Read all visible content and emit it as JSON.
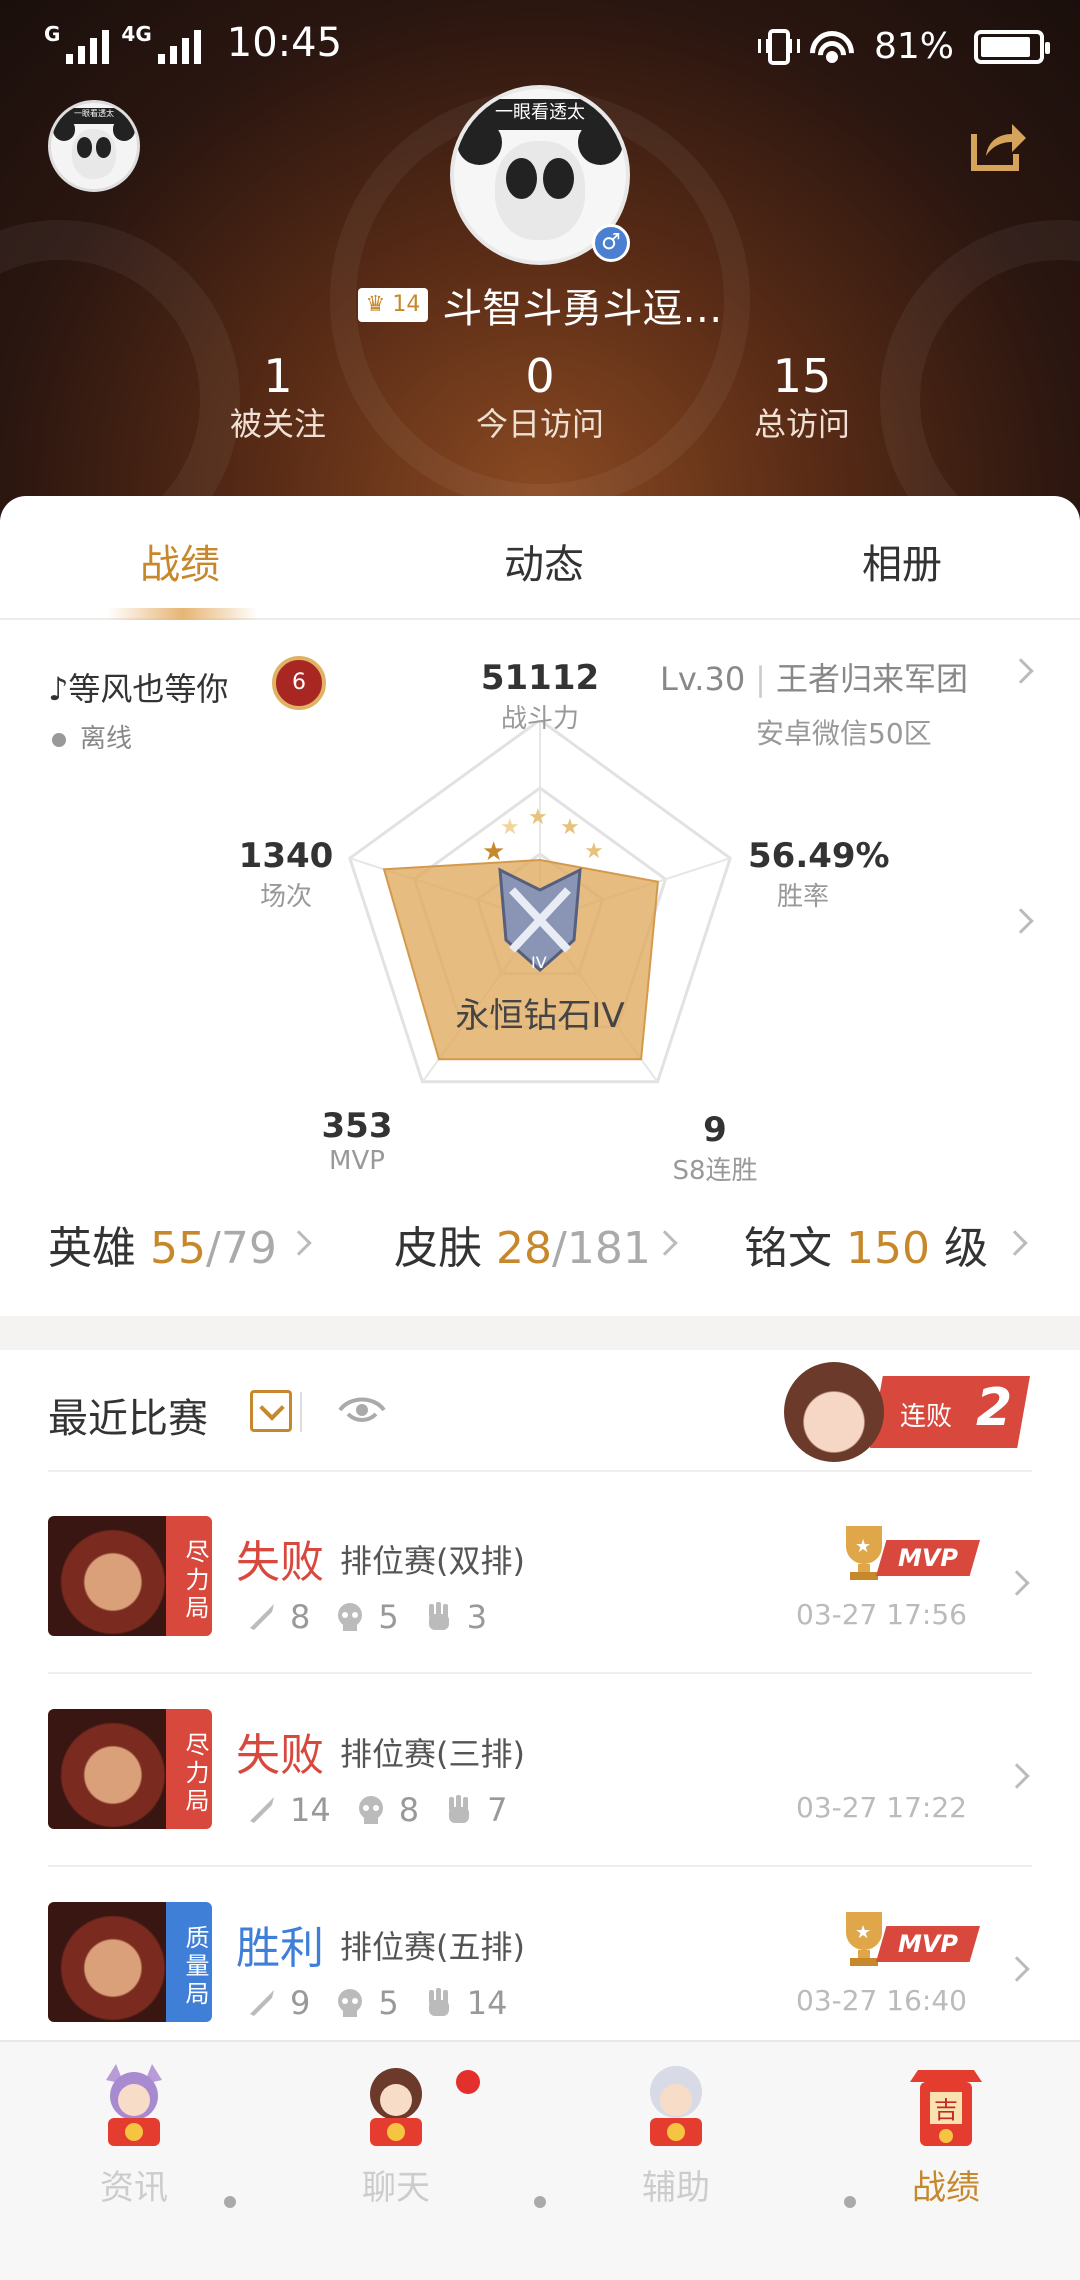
{
  "status_bar": {
    "net_left": "G",
    "net_right": "4G",
    "time": "10:45",
    "battery": "81%"
  },
  "profile": {
    "level_badge": "14",
    "name": "斗智斗勇斗逗…",
    "avatar_text": "一眼看透太",
    "stats": [
      {
        "value": "1",
        "label": "被关注"
      },
      {
        "value": "0",
        "label": "今日访问"
      },
      {
        "value": "15",
        "label": "总访问"
      }
    ]
  },
  "tabs": [
    {
      "label": "战绩",
      "active": true
    },
    {
      "label": "动态",
      "active": false
    },
    {
      "label": "相册",
      "active": false
    }
  ],
  "gamer": {
    "name": "♪等风也等你",
    "rank_badge": "6",
    "status": "离线",
    "level": "Lv.30",
    "team": "王者归来军团",
    "server": "安卓微信50区"
  },
  "radar": {
    "power_value": "51112",
    "power_label": "战斗力",
    "winrate_value": "56.49%",
    "winrate_label": "胜率",
    "streak_value": "9",
    "streak_label": "S8连胜",
    "mvp_value": "353",
    "mvp_label": "MVP",
    "games_value": "1340",
    "games_label": "场次",
    "rank_name": "永恒钻石IV",
    "axis_levels": [
      0.3,
      0.62,
      0.86,
      0.86,
      0.82
    ]
  },
  "counts": {
    "heroes_label": "英雄",
    "heroes_own": "55",
    "heroes_total": "/79",
    "skins_label": "皮肤",
    "skins_own": "28",
    "skins_total": "/181",
    "runes_label": "铭文",
    "runes_level": "150",
    "runes_unit": "级"
  },
  "matches": {
    "title": "最近比赛",
    "streak_text": "连败",
    "streak_num": "2",
    "items": [
      {
        "tag": "尽力局",
        "tag_color": "#d9483c",
        "result": "失败",
        "result_color": "#d9483c",
        "mode": "排位赛(双排)",
        "kills": "8",
        "deaths": "5",
        "assists": "3",
        "mvp": true,
        "mvp_text": "MVP",
        "time": "03-27 17:56"
      },
      {
        "tag": "尽力局",
        "tag_color": "#d9483c",
        "result": "失败",
        "result_color": "#d9483c",
        "mode": "排位赛(三排)",
        "kills": "14",
        "deaths": "8",
        "assists": "7",
        "mvp": false,
        "mvp_text": "",
        "time": "03-27 17:22"
      },
      {
        "tag": "质量局",
        "tag_color": "#3f7fd8",
        "result": "胜利",
        "result_color": "#3f7fd8",
        "mode": "排位赛(五排)",
        "kills": "9",
        "deaths": "5",
        "assists": "14",
        "mvp": true,
        "mvp_text": "MVP",
        "time": "03-27 16:40"
      }
    ]
  },
  "bottom_nav": [
    {
      "label": "资讯",
      "active": false,
      "icon": "news-icon"
    },
    {
      "label": "聊天",
      "active": false,
      "icon": "chat-icon"
    },
    {
      "label": "辅助",
      "active": false,
      "icon": "assist-icon"
    },
    {
      "label": "战绩",
      "active": true,
      "icon": "record-icon"
    }
  ],
  "colors": {
    "accent": "#c7882c",
    "loss": "#d9483c",
    "win": "#3f7fd8"
  }
}
